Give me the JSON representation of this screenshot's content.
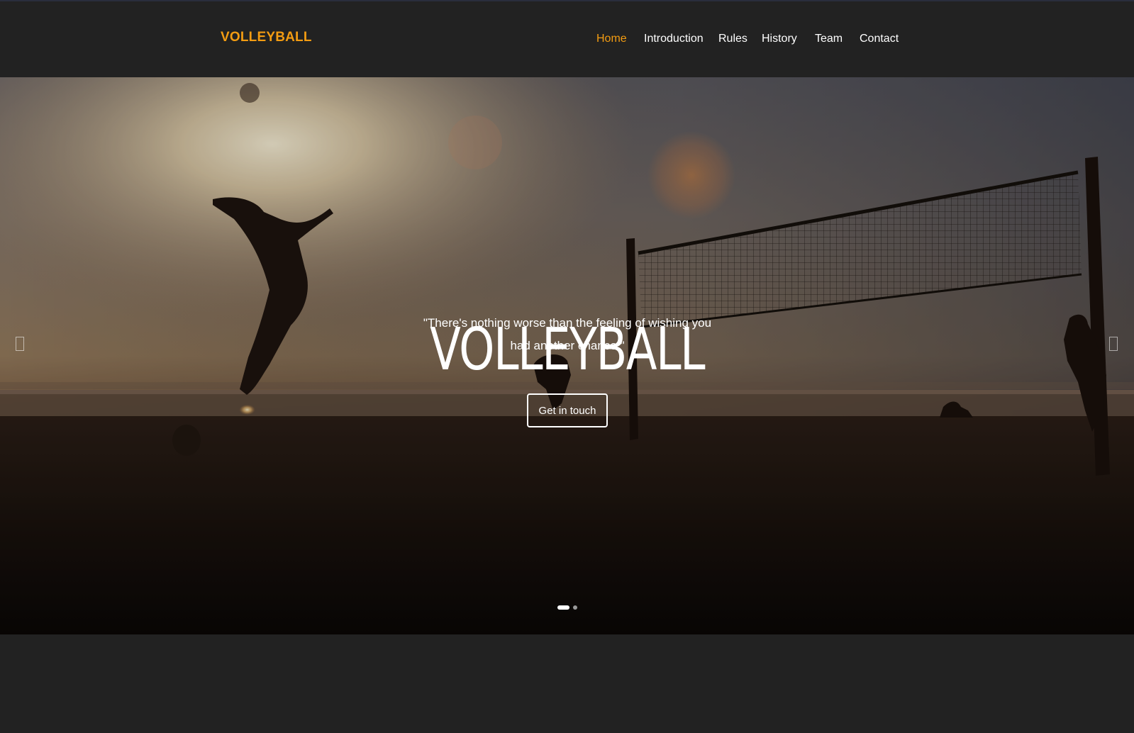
{
  "header": {
    "brand": "VOLLEYBALL",
    "nav": [
      {
        "label": "Home",
        "active": true
      },
      {
        "label": "Introduction",
        "active": false
      },
      {
        "label": "Rules",
        "active": false
      },
      {
        "label": "History",
        "active": false
      },
      {
        "label": "Team",
        "active": false
      },
      {
        "label": "Contact",
        "active": false
      }
    ]
  },
  "hero": {
    "title": "VOLLEYBALL",
    "quote_line1": "\"There's nothing worse than the feeling of wishing you",
    "quote_line2": "had another chance.\"",
    "cta_label": "Get in touch",
    "prev_icon": "chevron-left-icon",
    "next_icon": "chevron-right-icon",
    "slides_count": 2,
    "active_slide": 1
  },
  "colors": {
    "accent": "#f39c12",
    "background": "#222222",
    "text": "#ffffff"
  }
}
